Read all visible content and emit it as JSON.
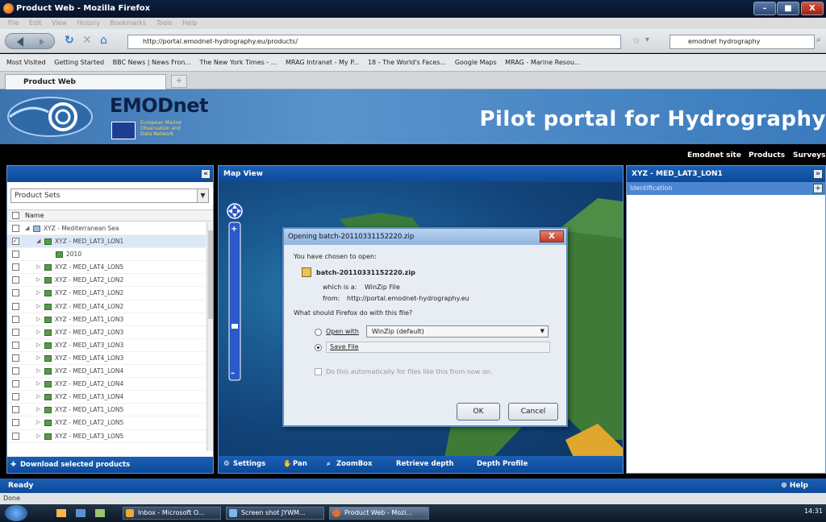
{
  "window": {
    "title": "Product Web - Mozilla Firefox",
    "controls": {
      "minimize": "–",
      "maximize": "■",
      "close": "X"
    }
  },
  "menubar": {
    "items": [
      "File",
      "Edit",
      "View",
      "History",
      "Bookmarks",
      "Tools",
      "Help"
    ]
  },
  "navbar": {
    "url": "http://portal.emodnet-hydrography.eu/products/",
    "search_value": "emodnet hydrography"
  },
  "bookmarks": {
    "items": [
      "Most Visited",
      "Getting Started",
      "BBC News | News Fron...",
      "The New York Times - ...",
      "MRAG Intranet - My P...",
      "18 - The World's Faces...",
      "Google Maps",
      "MRAG - Marine Resou..."
    ]
  },
  "tabs": {
    "active_label": "Product Web",
    "new_tab": "+"
  },
  "banner": {
    "logo_text": "EMODnet",
    "logo_sub_1": "European Marine",
    "logo_sub_2": "Observation and",
    "logo_sub_3": "Data Network",
    "portal_title": "Pilot portal for Hydrography"
  },
  "topnav": {
    "items": [
      "Emodnet site",
      "Products",
      "Surveys"
    ]
  },
  "left_panel": {
    "collapse_icon": "«",
    "product_set_placeholder": "Product Sets",
    "name_header": "Name",
    "tree": [
      {
        "label": "XYZ - Mediterranean Sea",
        "level": 0,
        "checked": false,
        "selected": false
      },
      {
        "label": "XYZ - MED_LAT3_LON1",
        "level": 1,
        "checked": true,
        "selected": true
      },
      {
        "label": "2010",
        "level": 2,
        "checked": false,
        "selected": false
      },
      {
        "label": "XYZ - MED_LAT4_LON5",
        "level": 1,
        "checked": false,
        "selected": false
      },
      {
        "label": "XYZ - MED_LAT2_LON2",
        "level": 1,
        "checked": false,
        "selected": false
      },
      {
        "label": "XYZ - MED_LAT3_LON2",
        "level": 1,
        "checked": false,
        "selected": false
      },
      {
        "label": "XYZ - MED_LAT4_LON2",
        "level": 1,
        "checked": false,
        "selected": false
      },
      {
        "label": "XYZ - MED_LAT1_LON3",
        "level": 1,
        "checked": false,
        "selected": false
      },
      {
        "label": "XYZ - MED_LAT2_LON3",
        "level": 1,
        "checked": false,
        "selected": false
      },
      {
        "label": "XYZ - MED_LAT3_LON3",
        "level": 1,
        "checked": false,
        "selected": false
      },
      {
        "label": "XYZ - MED_LAT4_LON3",
        "level": 1,
        "checked": false,
        "selected": false
      },
      {
        "label": "XYZ - MED_LAT1_LON4",
        "level": 1,
        "checked": false,
        "selected": false
      },
      {
        "label": "XYZ - MED_LAT2_LON4",
        "level": 1,
        "checked": false,
        "selected": false
      },
      {
        "label": "XYZ - MED_LAT3_LON4",
        "level": 1,
        "checked": false,
        "selected": false
      },
      {
        "label": "XYZ - MED_LAT1_LON5",
        "level": 1,
        "checked": false,
        "selected": false
      },
      {
        "label": "XYZ - MED_LAT2_LON5",
        "level": 1,
        "checked": false,
        "selected": false
      },
      {
        "label": "XYZ - MED_LAT3_LON5",
        "level": 1,
        "checked": false,
        "selected": false
      }
    ],
    "download_label": "Download selected products"
  },
  "map_view": {
    "title": "Map View",
    "zoom_in": "+",
    "zoom_out": "–",
    "tools": {
      "settings": "Settings",
      "pan": "Pan",
      "zoombox": "ZoomBox",
      "retrieve_depth": "Retrieve depth",
      "depth_profile": "Depth Profile"
    }
  },
  "right_panel": {
    "title": "XYZ - MED_LAT3_LON1",
    "identification": "Identification",
    "collapse_icon": "»",
    "expand_icon": "+"
  },
  "dialog": {
    "title": "Opening batch-20110331152220.zip",
    "close": "X",
    "chosen_to_open": "You have chosen to open:",
    "filename": "batch-20110331152220.zip",
    "which_is_label": "which is a:",
    "which_is_value": "WinZip File",
    "from_label": "from:",
    "from_value": "http://portal.emodnet-hydrography.eu",
    "question": "What should Firefox do with this file?",
    "open_with_label": "Open with",
    "open_with_app": "WinZip (default)",
    "save_file_label": "Save File",
    "auto_label": "Do this automatically for files like this from now on.",
    "ok": "OK",
    "cancel": "Cancel"
  },
  "statusbar": {
    "ready": "Ready",
    "help": "Help"
  },
  "firefox_status": {
    "text": "Done"
  },
  "taskbar": {
    "tasks": [
      "Inbox - Microsoft O...",
      "Screen shot JYWM...",
      "Product Web - Mozi..."
    ],
    "clock": "14:31"
  }
}
